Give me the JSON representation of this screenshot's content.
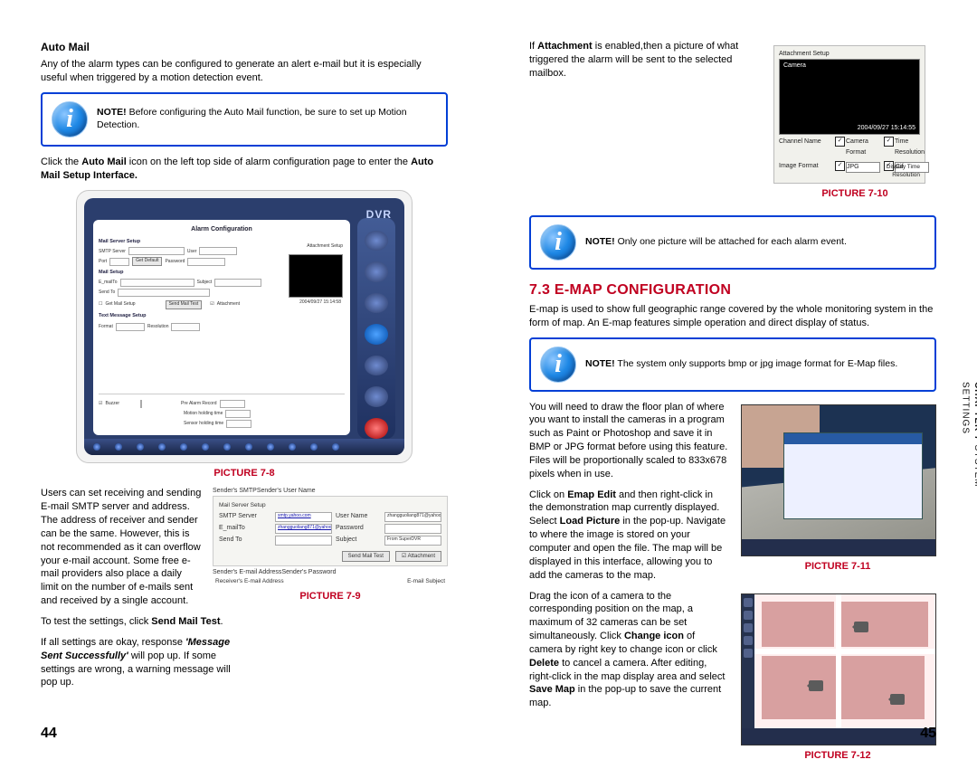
{
  "meta": {
    "chapter_label": "CHAPTER 7",
    "chapter_title": "SYSTEM SETTINGS",
    "page_left": "44",
    "page_right": "45"
  },
  "automail": {
    "heading": "Auto Mail",
    "intro": "Any of the alarm types can be configured to generate an alert e-mail but it is especially useful when triggered by a motion detection event.",
    "note1_label": "NOTE!",
    "note1": " Before configuring the Auto Mail function, be sure to set up Motion Detection.",
    "click_pre": "Click the ",
    "click_bold1": "Auto Mail",
    "click_mid": " icon on the left top side of alarm configuration page to enter the ",
    "click_bold2": "Auto Mail Setup Interface.",
    "fig78": {
      "caption": "PICTURE 7-8",
      "dvr_badge": "DVR",
      "title": "Alarm Configuration",
      "sec_mailserver": "Mail Server Setup",
      "lbl_smtp": "SMTP Server",
      "lbl_port": "Port",
      "btn_default": "Get Default",
      "lbl_user": "User",
      "lbl_pwd": "Password",
      "sec_mailsetup": "Mail Setup",
      "lbl_emailto": "E_mailTo",
      "lbl_subject": "Subject",
      "lbl_sendto": "Send To",
      "lbl_format": "Format",
      "lbl_res": "Resolution",
      "chk_getmail": "Get Mail Setup",
      "btn_sendtest": "Send Mail Test",
      "chk_attach": "Attachment",
      "sec_textmsg": "Text Message Setup",
      "chk_buzzer": "Buzzer",
      "lbl_prealarm": "Pre Alarm Record",
      "lbl_motion": "Motion holding time",
      "lbl_sensor": "Sensor holding time",
      "attach_hdr": "Attachment Setup",
      "attach_cam": "Camera",
      "attach_time": "2004/09/27 15:14:58"
    },
    "smtp_para": "Users can set receiving and sending E-mail SMTP server and address. The address of receiver and sender can be the same. However, this is not recommended as it can overflow your e-mail account. Some free e-mail providers also place a daily limit on the number of e-mails sent and received by a single account.",
    "fig79": {
      "caption": "PICTURE 7-9",
      "top_left": "Sender's SMTP",
      "top_right": "Sender's User Name",
      "section": "Mail Server Setup",
      "smtp": "SMTP Server",
      "smtp_val": "smtp.yahoo.com",
      "user": "User Name",
      "user_val": "zhangguoliang871@yahoo.com",
      "emailto": "E_mailTo",
      "emailto_val": "zhangguoliang871@yahoo.com",
      "pwd": "Password",
      "sendto": "Send To",
      "subject": "Subject",
      "subject_val": "From SuperDVR",
      "btn_test": "Send Mail Test",
      "btn_attach": "Attachment",
      "bot_left": "Sender's E-mail Address",
      "bot_right": "Sender's Password",
      "axis_left": "Receiver's E-mail Address",
      "axis_right": "E-mail Subject"
    },
    "test_pre": "To test the settings, click ",
    "test_bold": "Send Mail Test",
    "test_post": ".",
    "test_p2a": "If all settings are okay, response ",
    "test_p2b": "'Message Sent Successfully'",
    "test_p2c": " will pop up. If some settings are wrong, a warning message will pop up."
  },
  "rightcol": {
    "attach_pre": "If ",
    "attach_bold": "Attachment",
    "attach_post": " is enabled,then a picture of what triggered the alarm will be sent to the selected mailbox.",
    "fig710": {
      "caption": "PICTURE 7-10",
      "hdr": "Attachment Setup",
      "cam": "Camera",
      "time": "2004/09/27 15:14:55",
      "row1a": "Channel Name",
      "row1b": "Camera",
      "row1c": "Time",
      "row1d": "Display Time",
      "row2a": "Format",
      "row2b": "Resolution",
      "row3a": "Image Format",
      "row3b_val": "JPG",
      "row3c_val": "Cif",
      "row3d": "Resolution"
    },
    "note2_label": "NOTE!",
    "note2": " Only one picture will be attached for each alarm event.",
    "section": "7.3 E-MAP CONFIGURATION",
    "emap_intro": "E-map is used to show full geographic range covered by the whole monitoring system in the form of map. An E-map features simple operation and direct display of status.",
    "note3_label": "NOTE!",
    "note3": " The system only supports bmp or jpg image format for E-Map files.",
    "fig711": {
      "caption": "PICTURE 7-11"
    },
    "fig712": {
      "caption": "PICTURE 7-12"
    },
    "draw_p1": "You will need to draw the floor plan of where you want to install the cameras in a program such as Paint or Photoshop and save it in BMP or JPG format before using this feature. Files will be proportionally scaled to 833x678 pixels when in use.",
    "edit_pre": "Click on ",
    "edit_b1": "Emap Edit",
    "edit_mid1": " and then right-click in the demonstration map currently displayed. Select ",
    "edit_b2": "Load Picture",
    "edit_mid2": " in the pop-up. Navigate to where the image is stored on your computer and open the file. The map will be displayed in this interface, allowing you to add the cameras to the map.",
    "drag_p1a": "Drag the icon of a camera to the corresponding position on the map, a maximum of 32 cameras can be set simultaneously. Click ",
    "drag_b1": "Change icon",
    "drag_p1b": " of camera by right key to change icon or click ",
    "drag_b2": "Delete",
    "drag_p1c": " to cancel a camera. After editing, right-click in the map display area and select ",
    "drag_b3": "Save Map",
    "drag_p1d": " in the pop-up to save the current map."
  }
}
